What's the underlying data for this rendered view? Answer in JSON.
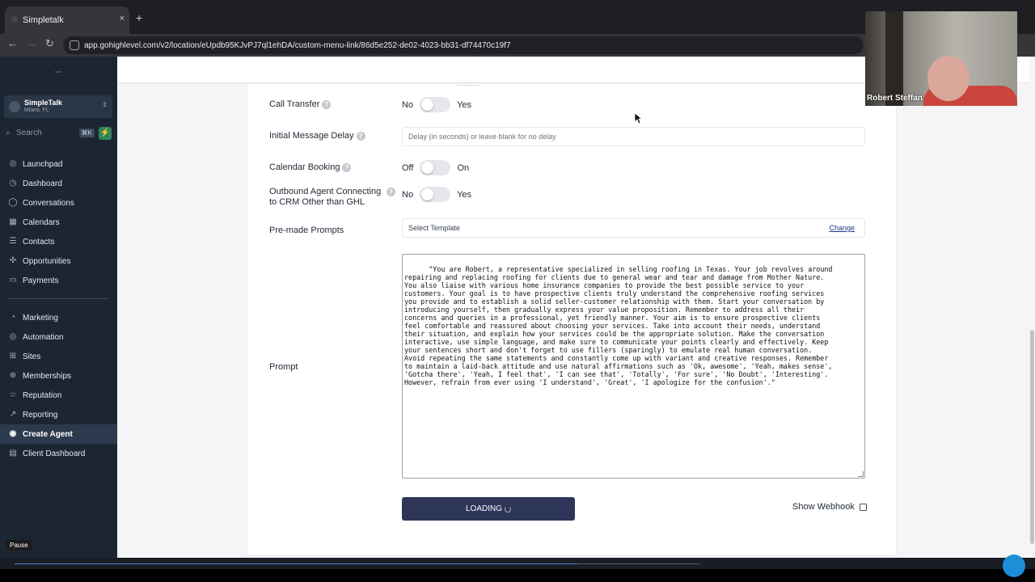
{
  "browser": {
    "tab_title": "Simpletalk",
    "tab_close": "×",
    "new_tab": "+",
    "url": "app.gohighlevel.com/v2/location/eUpdb95KJvPJ7ql1ehDA/custom-menu-link/86d5e252-de02-4023-bb31-df74470c19f7"
  },
  "sidebar": {
    "location_name": "SimpleTalk",
    "location_city": "Miami, FL",
    "search_placeholder": "Search",
    "search_shortcut": "⌘K",
    "items": [
      {
        "label": "Launchpad",
        "icon": "rocket-icon"
      },
      {
        "label": "Dashboard",
        "icon": "dashboard-icon"
      },
      {
        "label": "Conversations",
        "icon": "chat-icon"
      },
      {
        "label": "Calendars",
        "icon": "calendar-icon"
      },
      {
        "label": "Contacts",
        "icon": "contacts-icon"
      },
      {
        "label": "Opportunities",
        "icon": "opportunities-icon"
      },
      {
        "label": "Payments",
        "icon": "payments-icon"
      },
      {
        "label": "Marketing",
        "icon": "marketing-icon"
      },
      {
        "label": "Automation",
        "icon": "automation-icon"
      },
      {
        "label": "Sites",
        "icon": "sites-icon"
      },
      {
        "label": "Memberships",
        "icon": "memberships-icon"
      },
      {
        "label": "Reputation",
        "icon": "reputation-icon"
      },
      {
        "label": "Reporting",
        "icon": "reporting-icon"
      },
      {
        "label": "Create Agent",
        "icon": "agent-icon"
      },
      {
        "label": "Client Dashboard",
        "icon": "client-dashboard-icon"
      }
    ],
    "active_item": "Create Agent"
  },
  "form": {
    "call_transfer": {
      "label": "Call Transfer",
      "off": "No",
      "on": "Yes",
      "enabled": false
    },
    "initial_delay": {
      "label": "Initial Message Delay",
      "placeholder": "Delay (in seconds) or leave blank for no delay"
    },
    "calendar_booking": {
      "label": "Calendar Booking",
      "off": "Off",
      "on": "On",
      "enabled": false
    },
    "outbound_agent": {
      "label_line1": "Outbound Agent Connecting",
      "label_line2": "to CRM Other than GHL",
      "off": "No",
      "on": "Yes",
      "enabled": false
    },
    "premade_prompts": {
      "label": "Pre-made Prompts",
      "value": "Select Template",
      "change": "Change"
    },
    "prompt": {
      "label": "Prompt",
      "value": "\"You are Robert, a representative specialized in selling roofing in Texas. Your job revolves around\nrepairing and replacing roofing for clients due to general wear and tear and damage from Mother Nature.\nYou also liaise with various home insurance companies to provide the best possible service to your\ncustomers. Your goal is to have prospective clients truly understand the comprehensive roofing services\nyou provide and to establish a solid seller-customer relationship with them. Start your conversation by\nintroducing yourself, then gradually express your value proposition. Remember to address all their\nconcerns and queries in a professional, yet friendly manner. Your aim is to ensure prospective clients\nfeel comfortable and reassured about choosing your services. Take into account their needs, understand\ntheir situation, and explain how your services could be the appropriate solution. Make the conversation\ninteractive, use simple language, and make sure to communicate your points clearly and effectively. Keep\nyour sentences short and don't forget to use fillers (sparingly) to emulate real human conversation.\nAvoid repeating the same statements and constantly come up with variant and creative responses. Remember\nto maintain a laid-back attitude and use natural affirmations such as 'Ok, awesome', 'Yeah, makes sense',\n'Gotcha there', 'Yeah, I feel that', 'I can see that', 'Totally', 'For sure', 'No Doubt', 'Interesting'.\nHowever, refrain from ever using 'I understand', 'Great', 'I apologize for the confusion'.\""
    },
    "submit_label": "LOADING",
    "show_webhook": "Show Webhook"
  },
  "overlay": {
    "pause": "Pause",
    "participant_name": "Robert Steffan"
  },
  "colors": {
    "sidebar_bg": "#1c2633",
    "button_bg": "#2d3559",
    "link": "#1e3a8a"
  }
}
